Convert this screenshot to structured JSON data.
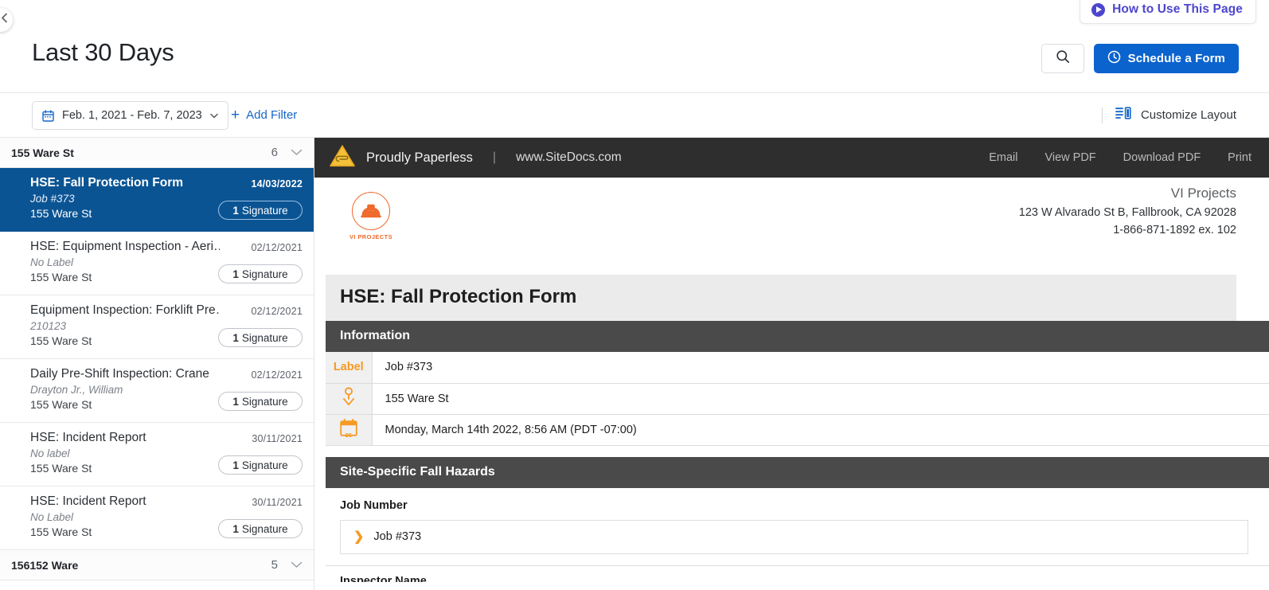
{
  "header": {
    "title": "Last 30 Days",
    "howto_label": "How to Use This Page",
    "search_icon": "search-icon",
    "schedule_label": "Schedule a Form",
    "clock_icon": "clock-icon"
  },
  "filter_bar": {
    "date_range": "Feb. 1, 2021 - Feb. 7, 2023",
    "calendar_icon": "calendar-icon",
    "add_filter": "Add Filter",
    "customize_layout": "Customize Layout"
  },
  "list": {
    "groups": [
      {
        "name": "155 Ware St",
        "count": "6"
      },
      {
        "name": "156152 Ware",
        "count": "5"
      }
    ],
    "rows": [
      {
        "name": "HSE: Fall Protection Form",
        "label": "Job #373",
        "location": "155 Ware St",
        "date": "14/03/2022",
        "signature_count": "1",
        "signature_text": "Signature",
        "selected": true
      },
      {
        "name": "HSE: Equipment Inspection - Aeri…",
        "label": "No Label",
        "location": "155 Ware St",
        "date": "02/12/2021",
        "signature_count": "1",
        "signature_text": "Signature",
        "selected": false
      },
      {
        "name": "Equipment Inspection: Forklift Pre…",
        "label": "210123",
        "location": "155 Ware St",
        "date": "02/12/2021",
        "signature_count": "1",
        "signature_text": "Signature",
        "selected": false
      },
      {
        "name": "Daily Pre-Shift Inspection: Crane",
        "label": "Drayton Jr., William",
        "location": "155 Ware St",
        "date": "02/12/2021",
        "signature_count": "1",
        "signature_text": "Signature",
        "selected": false
      },
      {
        "name": "HSE: Incident Report",
        "label": "No label",
        "location": "155 Ware St",
        "date": "30/11/2021",
        "signature_count": "1",
        "signature_text": "Signature",
        "selected": false
      },
      {
        "name": "HSE: Incident Report",
        "label": "No Label",
        "location": "155 Ware St",
        "date": "30/11/2021",
        "signature_count": "1",
        "signature_text": "Signature",
        "selected": false
      }
    ]
  },
  "document": {
    "toolbar": {
      "brand": "Proudly Paperless",
      "separator": "|",
      "url": "www.SiteDocs.com",
      "actions": [
        "Email",
        "View PDF",
        "Download PDF",
        "Print"
      ]
    },
    "company": {
      "logo_name": "VI PROJECTS",
      "name": "VI Projects",
      "address": "123 W Alvarado St B, Fallbrook, CA 92028",
      "phone": "1-866-871-1892 ex. 102"
    },
    "form_title": "HSE: Fall Protection Form",
    "sections": [
      {
        "heading": "Information",
        "rows": [
          {
            "icon": "label-text",
            "icon_text": "Label",
            "value": "Job #373"
          },
          {
            "icon": "map-pin-icon",
            "icon_text": "",
            "value": "155 Ware St"
          },
          {
            "icon": "calendar-icon",
            "icon_text": "26",
            "value": "Monday, March 14th 2022, 8:56 AM (PDT -07:00)"
          }
        ]
      },
      {
        "heading": "Site-Specific Fall Hazards",
        "field_title": "Job Number",
        "field_value": "Job #373",
        "next_field_title": "Inspector Name"
      }
    ]
  },
  "colors": {
    "accent_blue": "#0b63ce",
    "selected_row": "#0b5493",
    "brand_orange": "#ef6a2c",
    "field_orange": "#f59a23",
    "purple": "#4c46cf",
    "dark_toolbar": "#2e2e2e",
    "section_header": "#4a4a4a"
  }
}
